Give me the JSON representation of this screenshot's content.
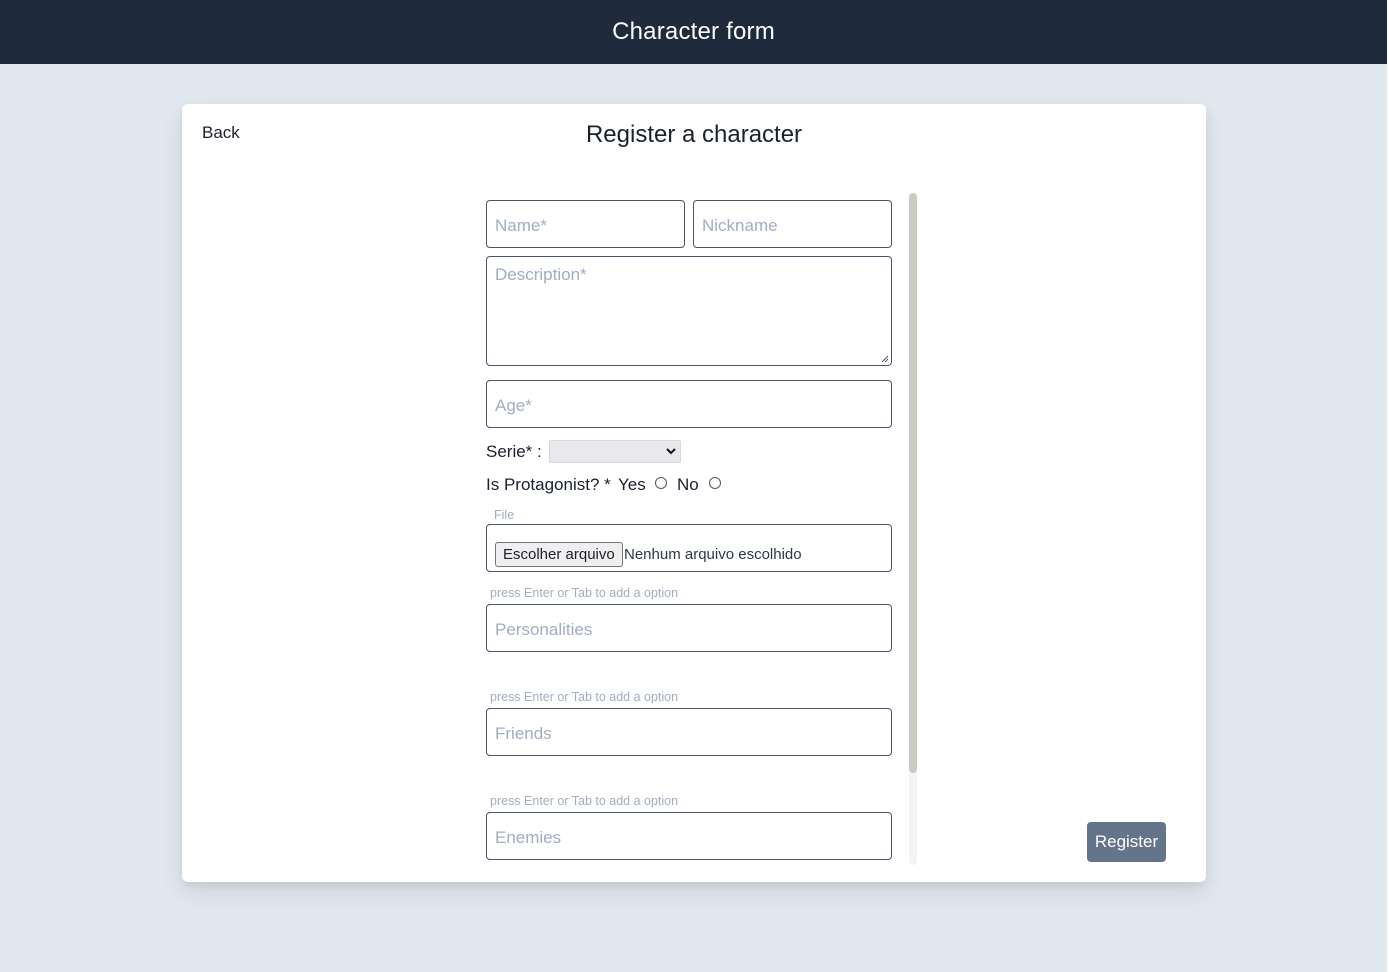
{
  "header": {
    "title": "Character form"
  },
  "card": {
    "back_label": "Back",
    "title": "Register a character"
  },
  "form": {
    "name_placeholder": "Name*",
    "nickname_placeholder": "Nickname",
    "description_placeholder": "Description*",
    "age_placeholder": "Age*",
    "serie_label": "Serie* :",
    "serie_value": "",
    "protagonist_label": "Is Protagonist? *",
    "yes_label": "Yes",
    "no_label": "No",
    "file_label": "File",
    "file_button": "Escolher arquivo",
    "file_status": "Nenhum arquivo escolhido",
    "personalities_hint": "press Enter or Tab to add a option",
    "personalities_placeholder": "Personalities",
    "friends_hint": "press Enter or Tab to add a option",
    "friends_placeholder": "Friends",
    "enemies_hint": "press Enter or Tab to add a option",
    "enemies_placeholder": "Enemies"
  },
  "actions": {
    "register_label": "Register"
  },
  "colors": {
    "header_bg": "#1f2a3c",
    "page_bg": "#e2e8f0",
    "register_bg": "#64748b"
  }
}
